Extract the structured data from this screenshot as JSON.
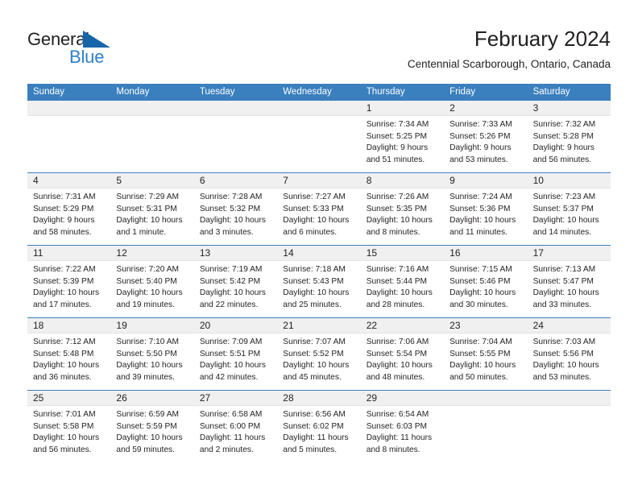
{
  "brand": {
    "name_part1": "General",
    "name_part2": "Blue",
    "triangle_color": "#1565a8",
    "blue_color": "#2f7fc8"
  },
  "header": {
    "title": "February 2024",
    "subtitle": "Centennial Scarborough, Ontario, Canada"
  },
  "theme": {
    "header_row_bg": "#3a7fbe",
    "day_band_bg": "#f0f0f0",
    "row_divider": "#3a7fbe"
  },
  "weekdays": [
    "Sunday",
    "Monday",
    "Tuesday",
    "Wednesday",
    "Thursday",
    "Friday",
    "Saturday"
  ],
  "weeks": [
    [
      {
        "day": "",
        "lines": []
      },
      {
        "day": "",
        "lines": []
      },
      {
        "day": "",
        "lines": []
      },
      {
        "day": "",
        "lines": []
      },
      {
        "day": "1",
        "lines": [
          "Sunrise: 7:34 AM",
          "Sunset: 5:25 PM",
          "Daylight: 9 hours",
          "and 51 minutes."
        ]
      },
      {
        "day": "2",
        "lines": [
          "Sunrise: 7:33 AM",
          "Sunset: 5:26 PM",
          "Daylight: 9 hours",
          "and 53 minutes."
        ]
      },
      {
        "day": "3",
        "lines": [
          "Sunrise: 7:32 AM",
          "Sunset: 5:28 PM",
          "Daylight: 9 hours",
          "and 56 minutes."
        ]
      }
    ],
    [
      {
        "day": "4",
        "lines": [
          "Sunrise: 7:31 AM",
          "Sunset: 5:29 PM",
          "Daylight: 9 hours",
          "and 58 minutes."
        ]
      },
      {
        "day": "5",
        "lines": [
          "Sunrise: 7:29 AM",
          "Sunset: 5:31 PM",
          "Daylight: 10 hours",
          "and 1 minute."
        ]
      },
      {
        "day": "6",
        "lines": [
          "Sunrise: 7:28 AM",
          "Sunset: 5:32 PM",
          "Daylight: 10 hours",
          "and 3 minutes."
        ]
      },
      {
        "day": "7",
        "lines": [
          "Sunrise: 7:27 AM",
          "Sunset: 5:33 PM",
          "Daylight: 10 hours",
          "and 6 minutes."
        ]
      },
      {
        "day": "8",
        "lines": [
          "Sunrise: 7:26 AM",
          "Sunset: 5:35 PM",
          "Daylight: 10 hours",
          "and 8 minutes."
        ]
      },
      {
        "day": "9",
        "lines": [
          "Sunrise: 7:24 AM",
          "Sunset: 5:36 PM",
          "Daylight: 10 hours",
          "and 11 minutes."
        ]
      },
      {
        "day": "10",
        "lines": [
          "Sunrise: 7:23 AM",
          "Sunset: 5:37 PM",
          "Daylight: 10 hours",
          "and 14 minutes."
        ]
      }
    ],
    [
      {
        "day": "11",
        "lines": [
          "Sunrise: 7:22 AM",
          "Sunset: 5:39 PM",
          "Daylight: 10 hours",
          "and 17 minutes."
        ]
      },
      {
        "day": "12",
        "lines": [
          "Sunrise: 7:20 AM",
          "Sunset: 5:40 PM",
          "Daylight: 10 hours",
          "and 19 minutes."
        ]
      },
      {
        "day": "13",
        "lines": [
          "Sunrise: 7:19 AM",
          "Sunset: 5:42 PM",
          "Daylight: 10 hours",
          "and 22 minutes."
        ]
      },
      {
        "day": "14",
        "lines": [
          "Sunrise: 7:18 AM",
          "Sunset: 5:43 PM",
          "Daylight: 10 hours",
          "and 25 minutes."
        ]
      },
      {
        "day": "15",
        "lines": [
          "Sunrise: 7:16 AM",
          "Sunset: 5:44 PM",
          "Daylight: 10 hours",
          "and 28 minutes."
        ]
      },
      {
        "day": "16",
        "lines": [
          "Sunrise: 7:15 AM",
          "Sunset: 5:46 PM",
          "Daylight: 10 hours",
          "and 30 minutes."
        ]
      },
      {
        "day": "17",
        "lines": [
          "Sunrise: 7:13 AM",
          "Sunset: 5:47 PM",
          "Daylight: 10 hours",
          "and 33 minutes."
        ]
      }
    ],
    [
      {
        "day": "18",
        "lines": [
          "Sunrise: 7:12 AM",
          "Sunset: 5:48 PM",
          "Daylight: 10 hours",
          "and 36 minutes."
        ]
      },
      {
        "day": "19",
        "lines": [
          "Sunrise: 7:10 AM",
          "Sunset: 5:50 PM",
          "Daylight: 10 hours",
          "and 39 minutes."
        ]
      },
      {
        "day": "20",
        "lines": [
          "Sunrise: 7:09 AM",
          "Sunset: 5:51 PM",
          "Daylight: 10 hours",
          "and 42 minutes."
        ]
      },
      {
        "day": "21",
        "lines": [
          "Sunrise: 7:07 AM",
          "Sunset: 5:52 PM",
          "Daylight: 10 hours",
          "and 45 minutes."
        ]
      },
      {
        "day": "22",
        "lines": [
          "Sunrise: 7:06 AM",
          "Sunset: 5:54 PM",
          "Daylight: 10 hours",
          "and 48 minutes."
        ]
      },
      {
        "day": "23",
        "lines": [
          "Sunrise: 7:04 AM",
          "Sunset: 5:55 PM",
          "Daylight: 10 hours",
          "and 50 minutes."
        ]
      },
      {
        "day": "24",
        "lines": [
          "Sunrise: 7:03 AM",
          "Sunset: 5:56 PM",
          "Daylight: 10 hours",
          "and 53 minutes."
        ]
      }
    ],
    [
      {
        "day": "25",
        "lines": [
          "Sunrise: 7:01 AM",
          "Sunset: 5:58 PM",
          "Daylight: 10 hours",
          "and 56 minutes."
        ]
      },
      {
        "day": "26",
        "lines": [
          "Sunrise: 6:59 AM",
          "Sunset: 5:59 PM",
          "Daylight: 10 hours",
          "and 59 minutes."
        ]
      },
      {
        "day": "27",
        "lines": [
          "Sunrise: 6:58 AM",
          "Sunset: 6:00 PM",
          "Daylight: 11 hours",
          "and 2 minutes."
        ]
      },
      {
        "day": "28",
        "lines": [
          "Sunrise: 6:56 AM",
          "Sunset: 6:02 PM",
          "Daylight: 11 hours",
          "and 5 minutes."
        ]
      },
      {
        "day": "29",
        "lines": [
          "Sunrise: 6:54 AM",
          "Sunset: 6:03 PM",
          "Daylight: 11 hours",
          "and 8 minutes."
        ]
      },
      {
        "day": "",
        "lines": []
      },
      {
        "day": "",
        "lines": []
      }
    ]
  ]
}
